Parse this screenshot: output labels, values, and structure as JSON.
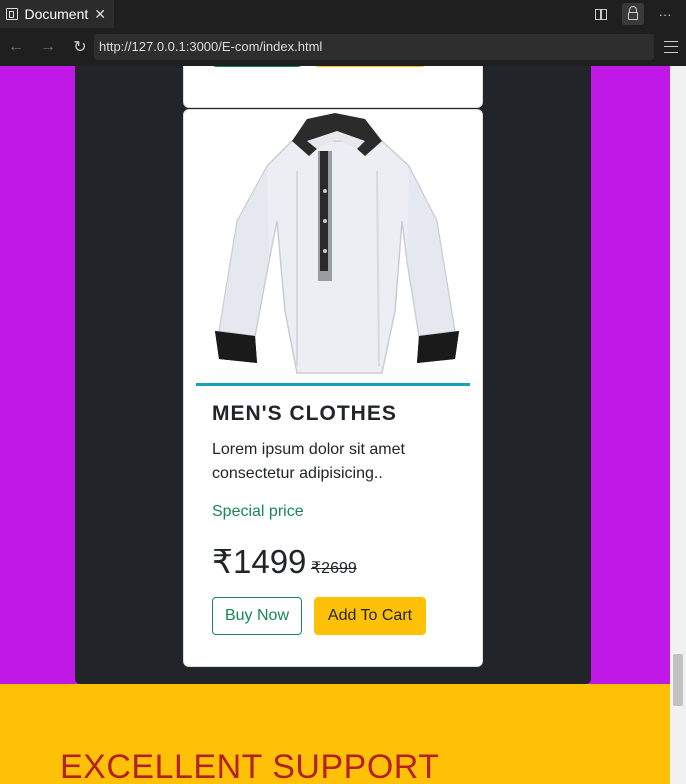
{
  "browser": {
    "tab_title": "Document",
    "url": "http://127.0.0.1:3000/E-com/index.html",
    "back_icon": "←",
    "forward_icon": "→",
    "reload_icon": "↻",
    "more_icon": "···",
    "close_icon": "✕"
  },
  "card": {
    "title": "MEN'S CLOTHES",
    "description": "Lorem ipsum dolor sit amet consectetur adipisicing..",
    "special_label": "Special price",
    "price": "₹1499",
    "old_price": "₹2699",
    "buy_label": "Buy Now",
    "cart_label": "Add To Cart"
  },
  "support": {
    "title": "EXCELLENT SUPPORT"
  },
  "colors": {
    "page_bg": "#c018e6",
    "panel_bg": "#212529",
    "accent_yellow": "#ffc107",
    "green": "#198754",
    "support_red": "#b22222",
    "rule_teal": "#17a2b8"
  }
}
